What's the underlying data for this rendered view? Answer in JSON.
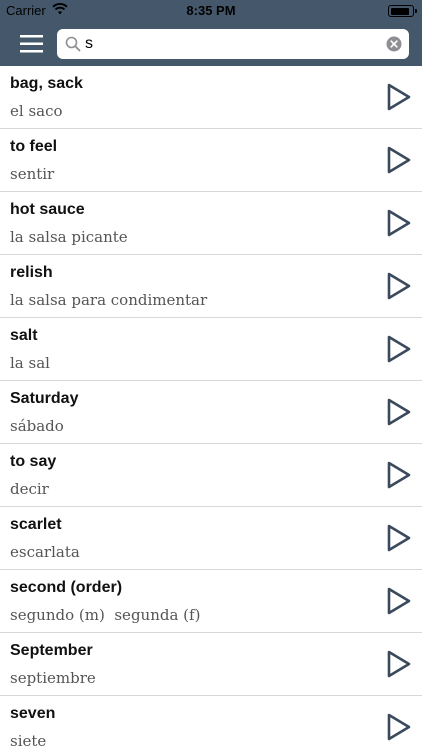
{
  "status_bar": {
    "carrier": "Carrier",
    "time": "8:35 PM",
    "battery_level": 0.92
  },
  "nav": {
    "search": {
      "value": "s",
      "placeholder": ""
    }
  },
  "entries": [
    {
      "english": "bag, sack",
      "spanish": "el saco"
    },
    {
      "english": "to feel",
      "spanish": "sentir"
    },
    {
      "english": "hot sauce",
      "spanish": "la salsa picante"
    },
    {
      "english": "relish",
      "spanish": "la salsa para condimentar"
    },
    {
      "english": "salt",
      "spanish": "la sal"
    },
    {
      "english": "Saturday",
      "spanish": "sábado"
    },
    {
      "english": "to say",
      "spanish": "decir"
    },
    {
      "english": "scarlet",
      "spanish": "escarlata"
    },
    {
      "english": "second (order)",
      "spanish": "segundo (m)  segunda (f)"
    },
    {
      "english": "September",
      "spanish": "septiembre"
    },
    {
      "english": "seven",
      "spanish": "siete"
    }
  ],
  "colors": {
    "nav_background": "#45586b",
    "play_icon": "#3a4a5c"
  },
  "icons": {
    "menu": "hamburger-menu-icon",
    "search": "search-icon",
    "clear": "clear-circle-x-icon",
    "play": "play-triangle-icon",
    "wifi": "wifi-icon",
    "battery": "battery-icon"
  }
}
